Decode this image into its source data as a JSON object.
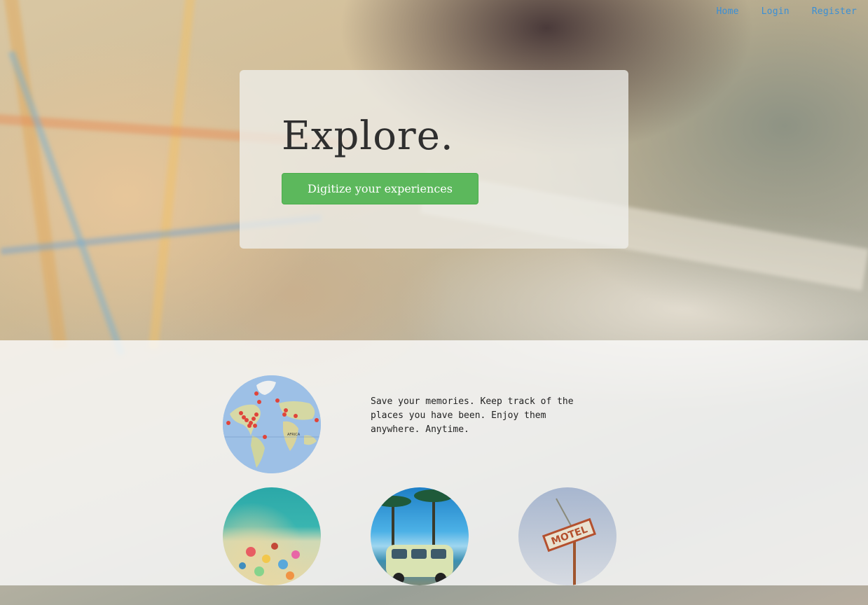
{
  "nav": {
    "home": "Home",
    "login": "Login",
    "register": "Register"
  },
  "hero": {
    "title": "Explore.",
    "cta_label": "Digitize your experiences"
  },
  "features": {
    "description": "Save your memories. Keep track of the places you have been. Enjoy them anywhere. Anytime.",
    "map_text": "AFRICA"
  },
  "colors": {
    "link": "#3a8fd6",
    "cta": "#5cb85c",
    "pin": "#e0443a"
  }
}
